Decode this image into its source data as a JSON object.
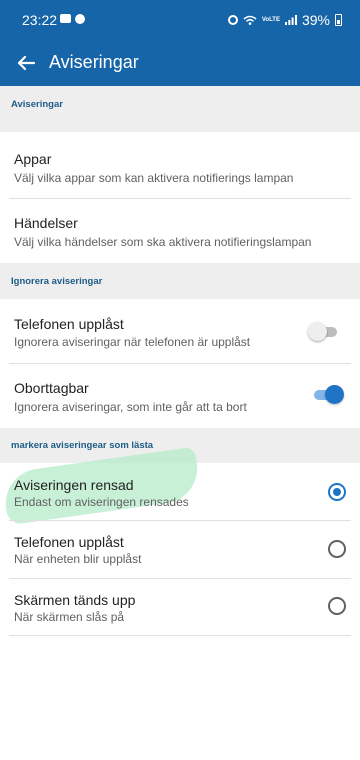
{
  "status_bar": {
    "time": "23:22",
    "battery_label": "39%",
    "lte_label": "VoLTE",
    "icons": [
      "message-icon",
      "messenger-icon",
      "alarm-icon",
      "wifi-icon",
      "signal-icon",
      "battery-icon"
    ]
  },
  "header": {
    "title": "Aviseringar",
    "back_icon": "arrow-left-icon"
  },
  "sections": {
    "notifications": {
      "label": "Aviseringar",
      "items": [
        {
          "title": "Appar",
          "subtitle": "Välj vilka appar som kan aktivera notifierings lampan"
        },
        {
          "title": "Händelser",
          "subtitle": "Välj vilka händelser som ska aktivera notifieringslampan"
        }
      ]
    },
    "ignore": {
      "label": "Ignorera aviseringar",
      "items": [
        {
          "title": "Telefonen upplåst",
          "subtitle": "Ignorera aviseringar när telefonen är upplåst",
          "enabled": false
        },
        {
          "title": "Oborttagbar",
          "subtitle": "Ignorera aviseringar, som inte går att ta bort",
          "enabled": true
        }
      ]
    },
    "mark_read": {
      "label": "markera aviseringear som lästa",
      "items": [
        {
          "title": "Aviseringen rensad",
          "subtitle": "Endast om aviseringen rensades",
          "selected": true
        },
        {
          "title": "Telefonen upplåst",
          "subtitle": "När enheten blir upplåst",
          "selected": false
        },
        {
          "title": "Skärmen tänds upp",
          "subtitle": "När skärmen slås på",
          "selected": false
        }
      ]
    }
  },
  "colors": {
    "primary": "#1565a8",
    "accent": "#1f74c6",
    "section_label": "#1d5c87",
    "highlight": "#b5ebc9"
  }
}
